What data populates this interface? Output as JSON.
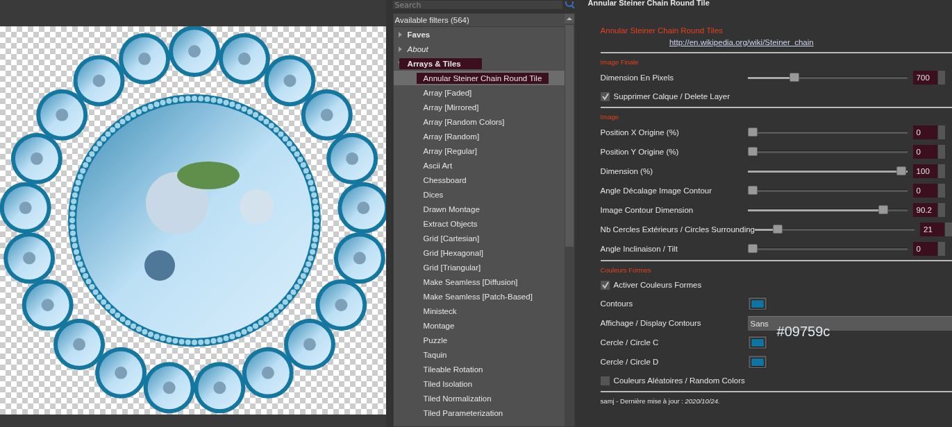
{
  "search": {
    "placeholder": "Search"
  },
  "filters": {
    "header": "Available filters (564)",
    "tree": [
      {
        "label": "Faves",
        "kind": "folder",
        "expanded": false,
        "selected": false
      },
      {
        "label": "About",
        "kind": "info",
        "expanded": false,
        "selected": false
      },
      {
        "label": "Arrays & Tiles",
        "kind": "folder",
        "expanded": true,
        "selected": true,
        "children": [
          {
            "label": "Annular Steiner Chain Round Tile",
            "selected": true
          },
          {
            "label": "Array [Faded]",
            "selected": false
          },
          {
            "label": "Array [Mirrored]",
            "selected": false
          },
          {
            "label": "Array [Random Colors]",
            "selected": false
          },
          {
            "label": "Array [Random]",
            "selected": false
          },
          {
            "label": "Array [Regular]",
            "selected": false
          },
          {
            "label": "Ascii Art",
            "selected": false
          },
          {
            "label": "Chessboard",
            "selected": false
          },
          {
            "label": "Dices",
            "selected": false
          },
          {
            "label": "Drawn Montage",
            "selected": false
          },
          {
            "label": "Extract Objects",
            "selected": false
          },
          {
            "label": "Grid [Cartesian]",
            "selected": false
          },
          {
            "label": "Grid [Hexagonal]",
            "selected": false
          },
          {
            "label": "Grid [Triangular]",
            "selected": false
          },
          {
            "label": "Make Seamless [Diffusion]",
            "selected": false
          },
          {
            "label": "Make Seamless [Patch-Based]",
            "selected": false
          },
          {
            "label": "Ministeck",
            "selected": false
          },
          {
            "label": "Montage",
            "selected": false
          },
          {
            "label": "Puzzle",
            "selected": false
          },
          {
            "label": "Taquin",
            "selected": false
          },
          {
            "label": "Tileable Rotation",
            "selected": false
          },
          {
            "label": "Tiled Isolation",
            "selected": false
          },
          {
            "label": "Tiled Normalization",
            "selected": false
          },
          {
            "label": "Tiled Parameterization",
            "selected": false
          }
        ]
      }
    ]
  },
  "filter": {
    "title": "Annular Steiner Chain Round Tile",
    "params": [
      {
        "kind": "title",
        "text": "Annular Steiner Chain Round Tiles"
      },
      {
        "kind": "link",
        "text": "http://en.wikipedia.org/wiki/Steiner_chain"
      },
      {
        "kind": "separator"
      },
      {
        "kind": "section",
        "text": "Image Finale"
      },
      {
        "kind": "slider",
        "label": "Dimension En Pixels",
        "level": 0.28,
        "value": "700"
      },
      {
        "kind": "checkbox",
        "label": "Supprimer Calque / Delete Layer",
        "checked": true
      },
      {
        "kind": "separator"
      },
      {
        "kind": "section",
        "text": "Image"
      },
      {
        "kind": "slider",
        "label": "Position X Origine (%)",
        "level": 0,
        "value": "0"
      },
      {
        "kind": "slider",
        "label": "Position Y Origine (%)",
        "level": 0,
        "value": "0"
      },
      {
        "kind": "slider",
        "label": "Dimension (%)",
        "level": 1,
        "value": "100"
      },
      {
        "kind": "slider",
        "label": "Angle Décalage Image Contour",
        "level": 0,
        "value": "0"
      },
      {
        "kind": "slider",
        "label": "Image Contour Dimension",
        "level": 0.88,
        "value": "90.2"
      },
      {
        "kind": "slider",
        "label": "Nb Cercles Extérieurs / Circles Surrounding",
        "level": 0.12,
        "value": "21"
      },
      {
        "kind": "slider",
        "label": "Angle Inclinaison / Tilt",
        "level": 0,
        "value": "0"
      },
      {
        "kind": "separator"
      },
      {
        "kind": "section",
        "text": "Couleurs Formes"
      },
      {
        "kind": "checkbox",
        "label": "Activer Couleurs Formes",
        "checked": true
      },
      {
        "kind": "color",
        "label": "Contours",
        "color": "#0f75a0"
      },
      {
        "kind": "choice",
        "label": "Affichage / Display Contours",
        "value": "Sans"
      },
      {
        "kind": "color",
        "label": "Cercle / Circle C",
        "color": "#0f75a0",
        "note": "#09759c"
      },
      {
        "kind": "color",
        "label": "Cercle / Circle D",
        "color": "#0f75a0"
      },
      {
        "kind": "checkbox",
        "label": "Couleurs Aléatoires / Random Colors",
        "checked": false
      },
      {
        "kind": "separator"
      },
      {
        "kind": "note",
        "text": "samj - Dernière mise à jour : *2020/10/24.*"
      }
    ]
  }
}
